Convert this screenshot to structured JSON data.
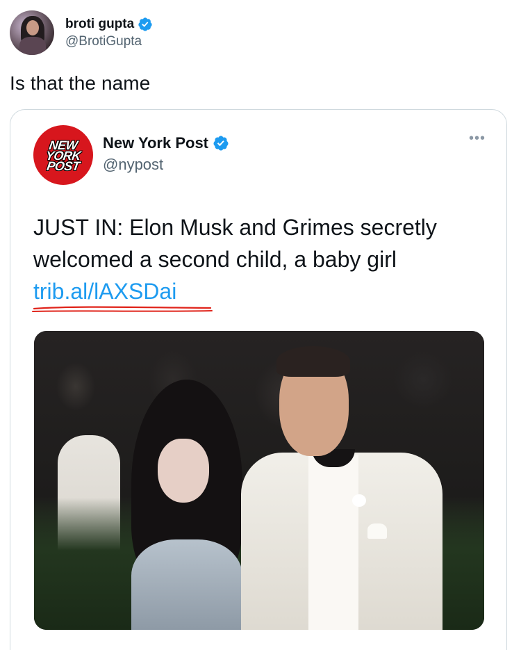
{
  "author": {
    "display_name": "broti gupta",
    "handle": "@BrotiGupta",
    "verified": true,
    "avatar_icon": "profile-photo"
  },
  "tweet": {
    "text": "Is that the name"
  },
  "quoted": {
    "display_name": "New York Post",
    "handle": "@nypost",
    "verified": true,
    "logo_words": [
      "NEW",
      "YORK",
      "POST"
    ],
    "text": "JUST IN: Elon Musk and Grimes secretly welcomed a second child, a baby girl",
    "link": "trib.al/lAXSDai",
    "more_icon": "more-options-icon"
  },
  "colors": {
    "verified_blue": "#1d9bf0",
    "link_blue": "#1d9bf0",
    "nyp_red": "#d7161d",
    "annotation_red": "#e0241b",
    "secondary_text": "#536471",
    "card_border": "#cfd9de"
  }
}
